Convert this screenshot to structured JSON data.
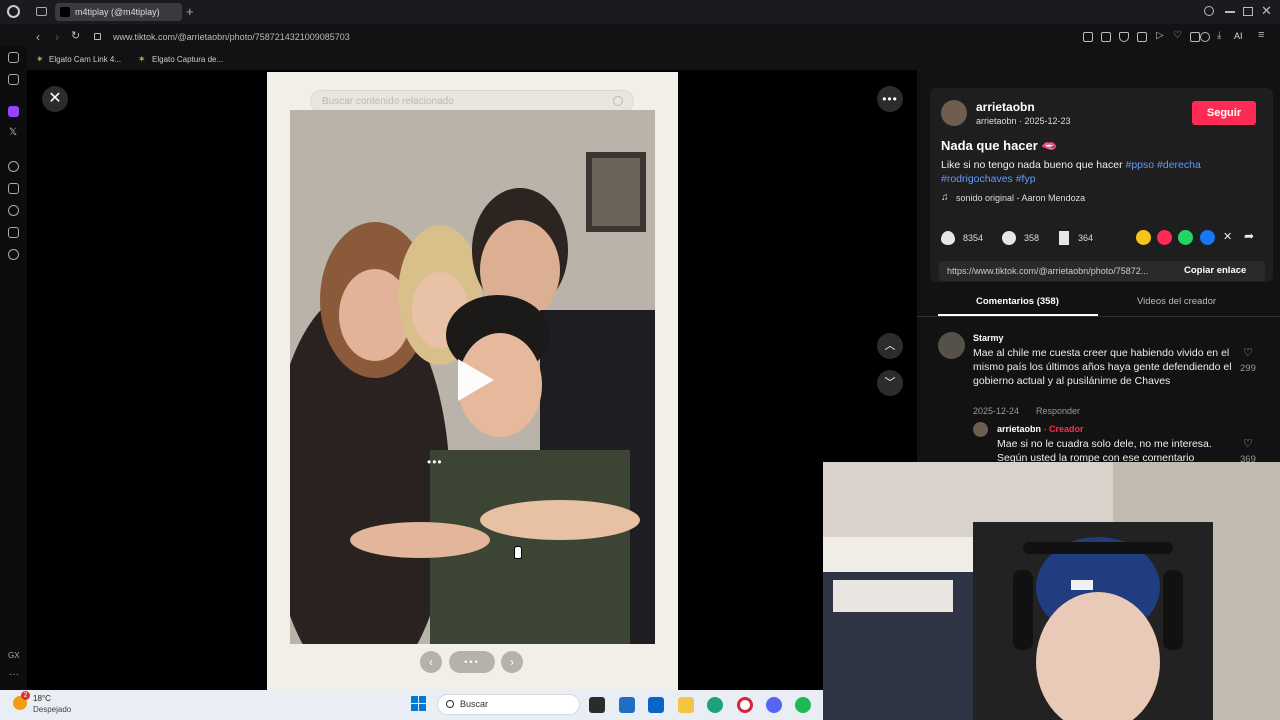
{
  "browser": {
    "tab_title": "m4tiplay (@m4tiplay)",
    "url": "www.tiktok.com/@arrietaobn/photo/7587214321009085703",
    "bookmarks": [
      "Elgato Cam Link 4...",
      "Elgato Captura de..."
    ],
    "right_tool_label": "AI",
    "sidebar_label": "GX"
  },
  "viewer": {
    "search_placeholder": "Buscar contenido relacionado"
  },
  "post": {
    "username": "arrietaobn",
    "subline": "arrietaobn · 2025-12-23",
    "follow_label": "Seguir",
    "title": "Nada que hacer 🫦",
    "caption_text": "Like si no tengo nada bueno que hacer",
    "hashtags_line1": [
      "#ppso",
      "#derecha"
    ],
    "hashtags_line2": [
      "#rodrigochaves",
      "#fyp"
    ],
    "sound": "sonido original - Aaron Mendoza",
    "likes": "8354",
    "comments": "358",
    "saves": "364",
    "share_url": "https://www.tiktok.com/@arrietaobn/photo/75872...",
    "copy_label": "Copiar enlace",
    "tab_comments": "Comentarios (358)",
    "tab_videos": "Videos del creador"
  },
  "comments": [
    {
      "author": "Starmy",
      "text": "Mae al chile me cuesta creer que habiendo vivido en el mismo país los últimos años haya gente defendiendo el gobierno actual y al pusilánime de Chaves",
      "date": "2025-12-24",
      "reply_label": "Responder",
      "likes": "299"
    },
    {
      "author": "arrietaobn",
      "creator_tag": "Creador",
      "text": "Mae si no le cuadra solo dele, no me interesa. Según usted la rompe con ese comentario",
      "likes": "369"
    }
  ],
  "taskbar": {
    "temperature": "18°C",
    "weather": "Despejado",
    "search_label": "Buscar",
    "notification_count": "2"
  },
  "colors": {
    "follow": "#fe2c55",
    "hashtag": "#5f9cff",
    "creator": "#fe2c55"
  }
}
